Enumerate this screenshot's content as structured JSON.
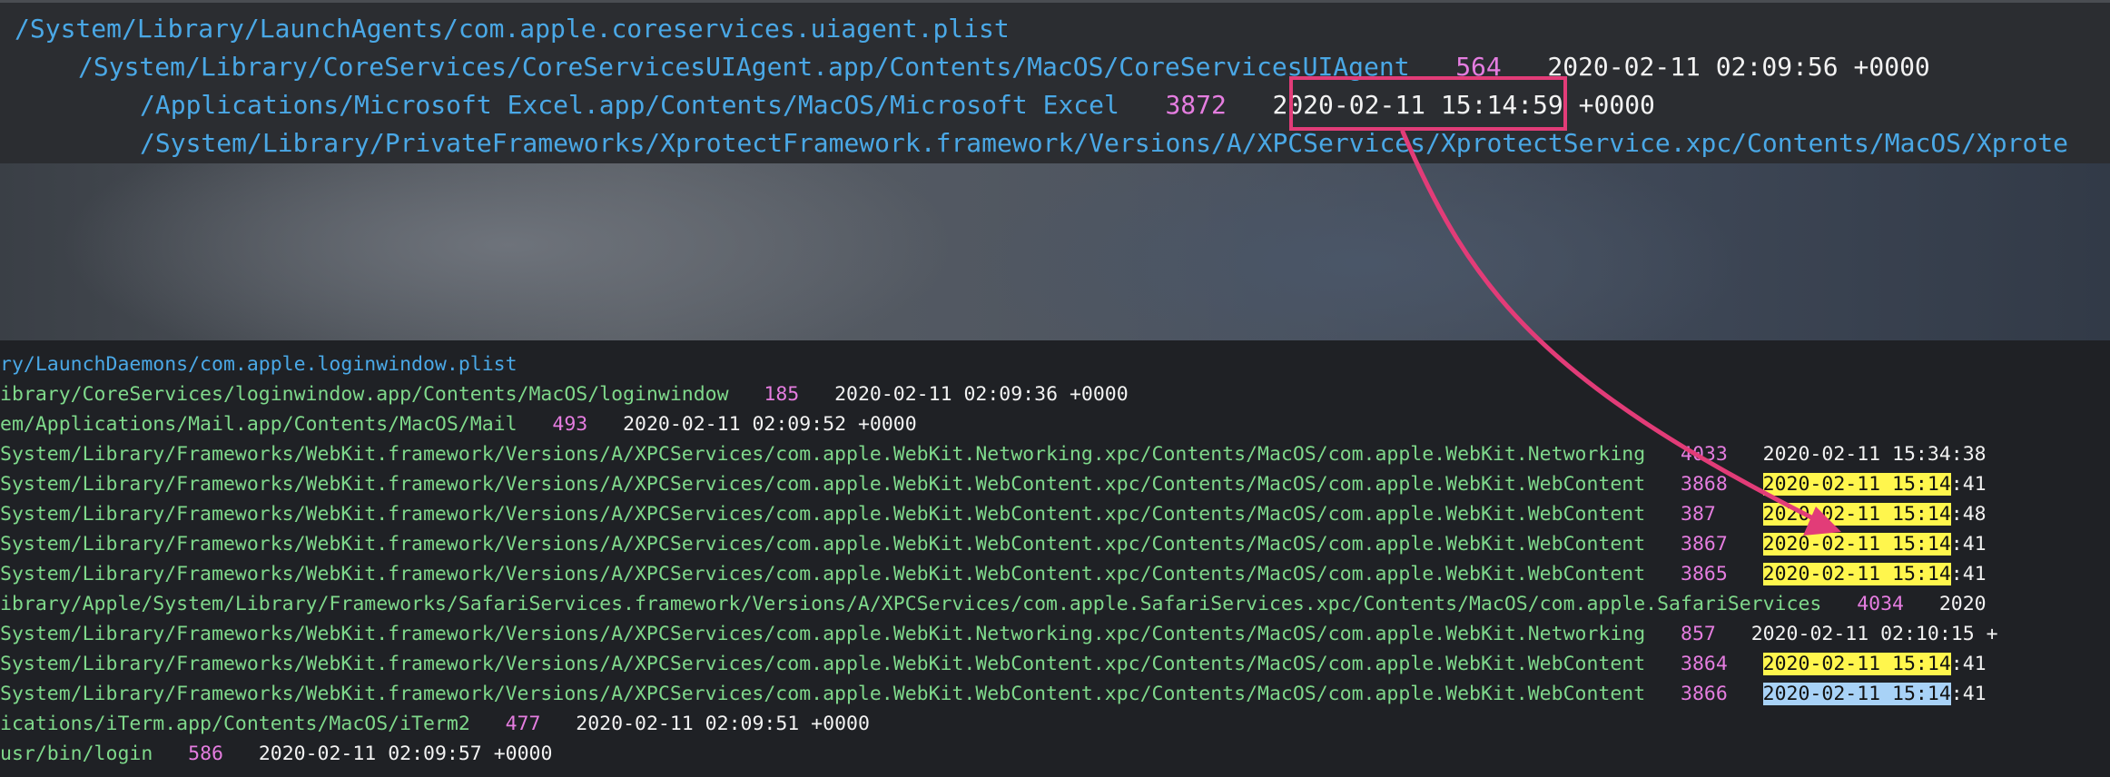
{
  "colors": {
    "plist_blue": "#4aa8e6",
    "path_green": "#7fd98b",
    "pid_magenta": "#e57de0",
    "date_white": "#f2f2f2",
    "highlight_yellow": "#fff64d",
    "highlight_blue": "#a8d2f7",
    "annotation_pink": "#e23c78"
  },
  "top": {
    "lines": [
      {
        "path": "/System/Library/LaunchAgents/com.apple.coreservices.uiagent.plist"
      },
      {
        "path": "/System/Library/CoreServices/CoreServicesUIAgent.app/Contents/MacOS/CoreServicesUIAgent",
        "pid": "564",
        "date": "2020-02-11 02:09:56 +0000"
      },
      {
        "path": "/Applications/Microsoft Excel.app/Contents/MacOS/Microsoft Excel",
        "pid": "3872",
        "date_hl": "2020-02-11 15:14",
        "date_rest": ":59 +0000"
      },
      {
        "path": "/System/Library/PrivateFrameworks/XprotectFramework.framework/Versions/A/XPCServices/XprotectService.xpc/Contents/MacOS/Xprote"
      }
    ]
  },
  "bottom": {
    "lines": [
      {
        "path": "ry/LaunchDaemons/com.apple.loginwindow.plist"
      },
      {
        "path": "ibrary/CoreServices/loginwindow.app/Contents/MacOS/loginwindow",
        "pid": "185",
        "date": "2020-02-11 02:09:36 +0000"
      },
      {
        "path": "em/Applications/Mail.app/Contents/MacOS/Mail",
        "pid": "493",
        "date": "2020-02-11 02:09:52 +0000"
      },
      {
        "path": "System/Library/Frameworks/WebKit.framework/Versions/A/XPCServices/com.apple.WebKit.Networking.xpc/Contents/MacOS/com.apple.WebKit.Networking",
        "pid": "4033",
        "date": "2020-02-11 15:34:38"
      },
      {
        "path": "System/Library/Frameworks/WebKit.framework/Versions/A/XPCServices/com.apple.WebKit.WebContent.xpc/Contents/MacOS/com.apple.WebKit.WebContent",
        "pid": "3868",
        "date_hl": "2020-02-11 15:14",
        "date_rest": ":41"
      },
      {
        "path": "System/Library/Frameworks/WebKit.framework/Versions/A/XPCServices/com.apple.WebKit.WebContent.xpc/Contents/MacOS/com.apple.WebKit.WebContent",
        "pid": "387",
        "date_hl": "2020-02-11 15:14",
        "date_rest": ":48"
      },
      {
        "path": "System/Library/Frameworks/WebKit.framework/Versions/A/XPCServices/com.apple.WebKit.WebContent.xpc/Contents/MacOS/com.apple.WebKit.WebContent",
        "pid": "3867",
        "date_hl": "2020-02-11 15:14",
        "date_rest": ":41"
      },
      {
        "path": "System/Library/Frameworks/WebKit.framework/Versions/A/XPCServices/com.apple.WebKit.WebContent.xpc/Contents/MacOS/com.apple.WebKit.WebContent",
        "pid": "3865",
        "date_hl": "2020-02-11 15:14",
        "date_rest": ":41"
      },
      {
        "path": "ibrary/Apple/System/Library/Frameworks/SafariServices.framework/Versions/A/XPCServices/com.apple.SafariServices.xpc/Contents/MacOS/com.apple.SafariServices",
        "pid": "4034",
        "date": "2020"
      },
      {
        "path": "System/Library/Frameworks/WebKit.framework/Versions/A/XPCServices/com.apple.WebKit.Networking.xpc/Contents/MacOS/com.apple.WebKit.Networking",
        "pid": "857",
        "date": "2020-02-11 02:10:15 +"
      },
      {
        "path": "System/Library/Frameworks/WebKit.framework/Versions/A/XPCServices/com.apple.WebKit.WebContent.xpc/Contents/MacOS/com.apple.WebKit.WebContent",
        "pid": "3864",
        "date_hl": "2020-02-11 15:14",
        "date_rest": ":41"
      },
      {
        "path": "System/Library/Frameworks/WebKit.framework/Versions/A/XPCServices/com.apple.WebKit.WebContent.xpc/Contents/MacOS/com.apple.WebKit.WebContent",
        "pid": "3866",
        "date_hl": "2020-02-11 15:14",
        "date_rest": ":41"
      },
      {
        "path": "ications/iTerm.app/Contents/MacOS/iTerm2",
        "pid": "477",
        "date": "2020-02-11 02:09:51 +0000"
      },
      {
        "path": "usr/bin/login",
        "pid": "586",
        "date": "2020-02-11 02:09:57 +0000"
      }
    ]
  }
}
